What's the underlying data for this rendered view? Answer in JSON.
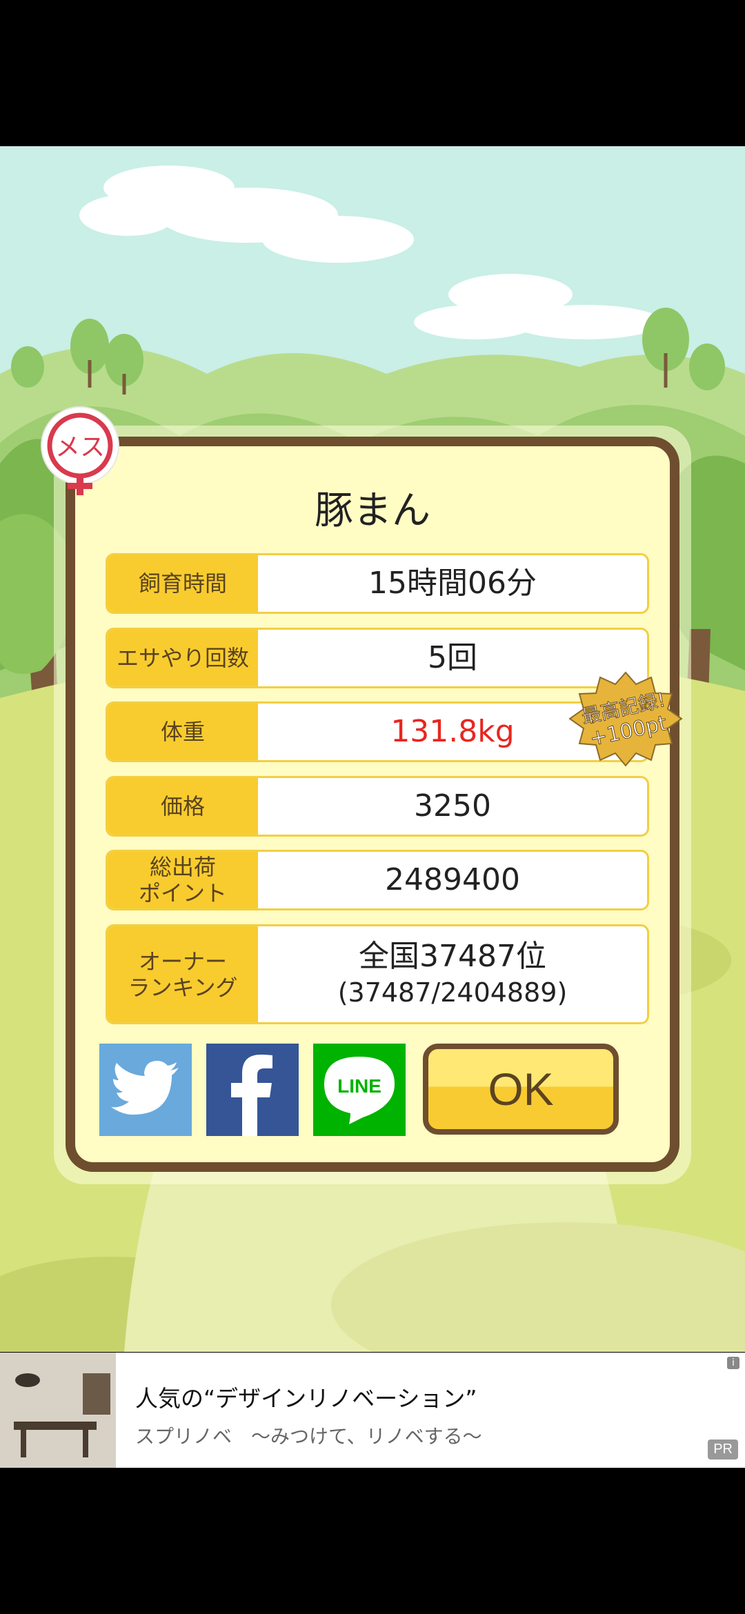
{
  "pig": {
    "name": "豚まん",
    "gender_badge": "メス"
  },
  "stats": [
    {
      "label": "飼育時間",
      "value": "15時間06分"
    },
    {
      "label": "エサやり回数",
      "value": "5回"
    },
    {
      "label": "体重",
      "value": "131.8kg"
    },
    {
      "label": "価格",
      "value": "3250"
    },
    {
      "label_line1": "総出荷",
      "label_line2": "ポイント",
      "value": "2489400"
    },
    {
      "label_line1": "オーナー",
      "label_line2": "ランキング",
      "value": "全国37487位",
      "value_sub": "(37487/2404889)"
    }
  ],
  "record_badge": {
    "line1": "最高記録!",
    "line2": "+100pt"
  },
  "buttons": {
    "ok": "OK",
    "line": "LINE"
  },
  "ad": {
    "title": "人気の“デザインリノベーション”",
    "subtitle": "スプリノベ　～みつけて、リノベする～",
    "pr": "PR",
    "info": "i"
  },
  "colors": {
    "accent": "#f8cc2e",
    "frame": "#6e4e2e",
    "record_value": "#e8261f"
  }
}
